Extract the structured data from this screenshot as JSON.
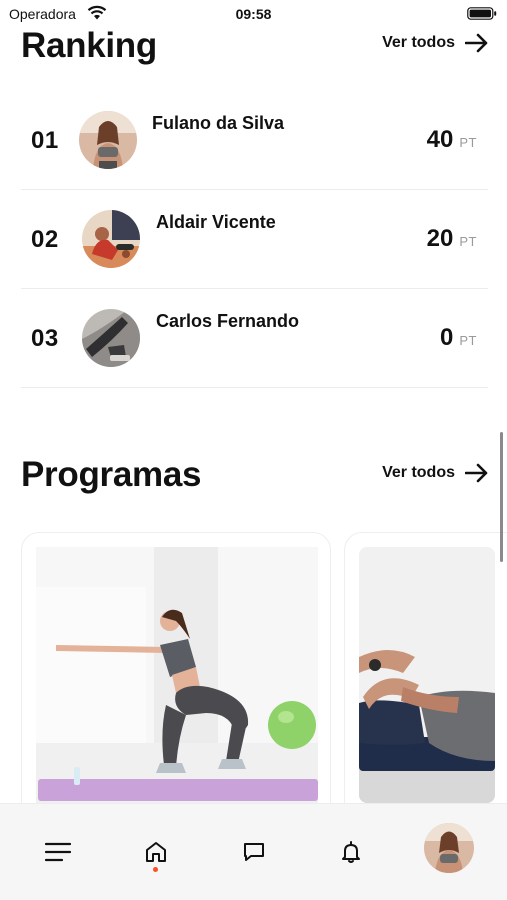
{
  "status_bar": {
    "carrier": "Operadora",
    "time": "09:58"
  },
  "ranking": {
    "title": "Ranking",
    "see_all_label": "Ver todos",
    "entries": [
      {
        "position": "01",
        "name": "Fulano da Silva",
        "points": "40",
        "unit": "PT"
      },
      {
        "position": "02",
        "name": "Aldair Vicente",
        "points": "20",
        "unit": "PT"
      },
      {
        "position": "03",
        "name": "Carlos Fernando",
        "points": "0",
        "unit": "PT"
      }
    ]
  },
  "programs": {
    "title": "Programas",
    "see_all_label": "Ver todos"
  },
  "tab_bar": {
    "items": [
      "menu-icon",
      "home-icon",
      "chat-icon",
      "bell-icon",
      "profile-avatar"
    ],
    "active": "home-icon",
    "active_indicator_color": "#ff4d1f"
  },
  "colors": {
    "text": "#111111",
    "muted": "#9a9a9a",
    "divider": "#ececec",
    "tab_bg": "#f6f6f6"
  }
}
